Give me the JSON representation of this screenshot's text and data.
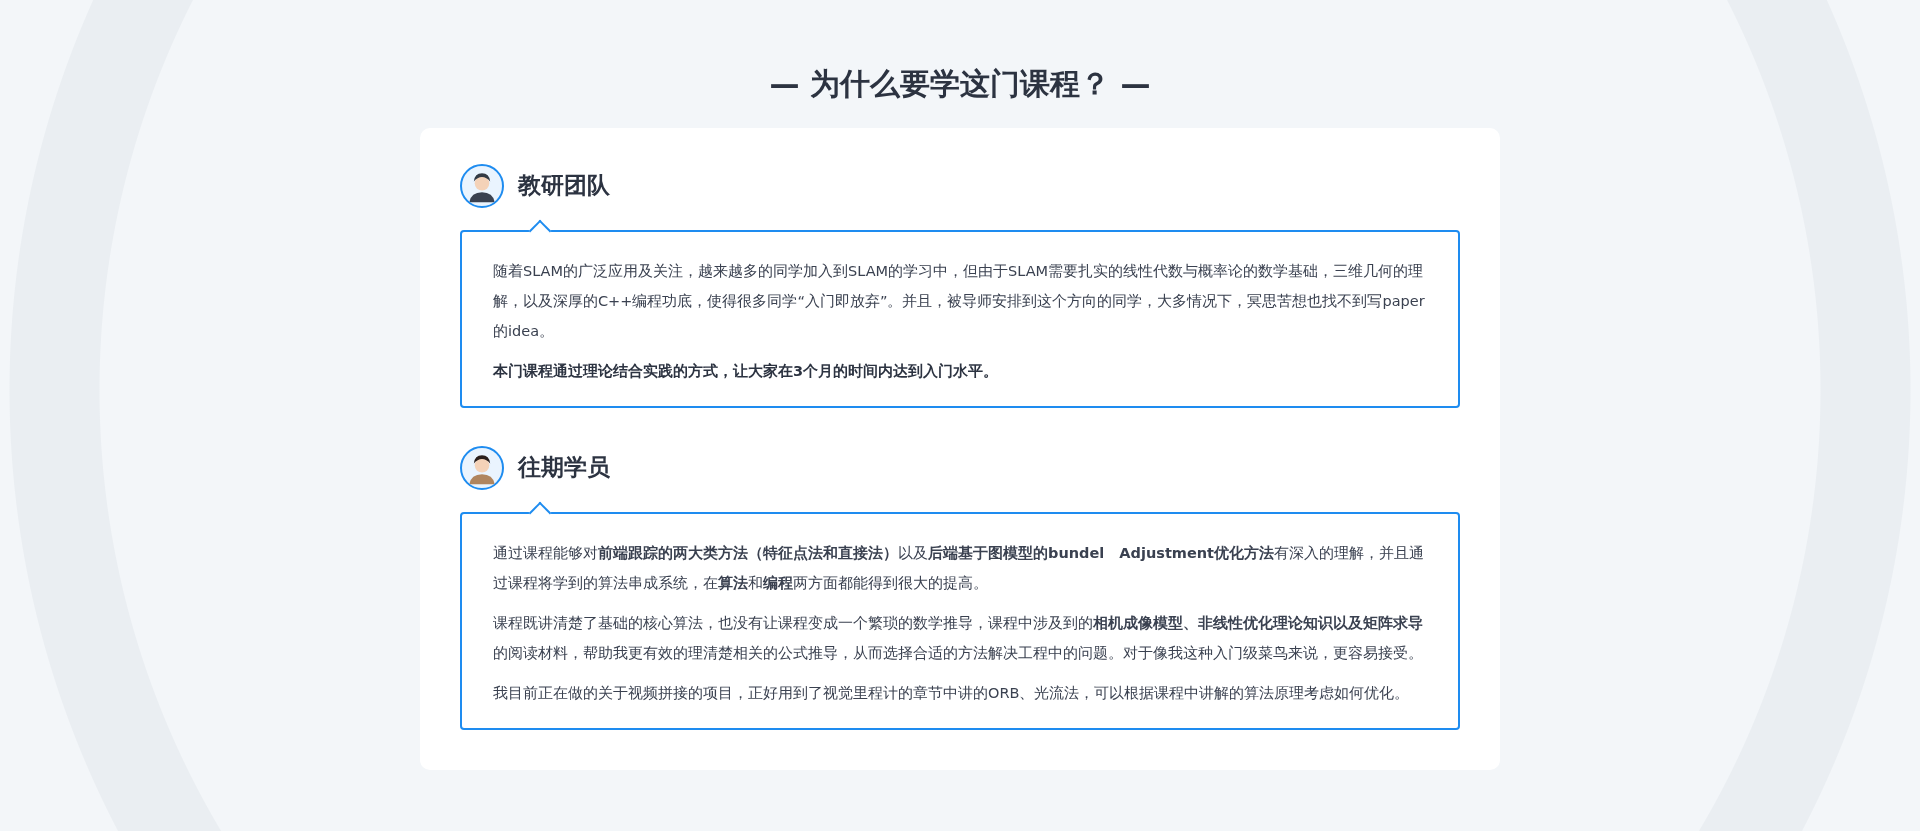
{
  "page_title": "— 为什么要学这门课程？ —",
  "sections": [
    {
      "heading": "教研团队",
      "kind": "teacher",
      "paragraphs": [
        {
          "text": "随着SLAM的广泛应用及关注，越来越多的同学加入到SLAM的学习中，但由于SLAM需要扎实的线性代数与概率论的数学基础，三维几何的理解，以及深厚的C++编程功底，使得很多同学“入门即放弃”。并且，被导师安排到这个方向的同学，大多情况下，冥思苦想也找不到写paper的idea。",
          "bold": false
        },
        {
          "text": "本门课程通过理论结合实践的方式，让大家在3个月的时间内达到入门水平。",
          "bold": true
        }
      ]
    },
    {
      "heading": "往期学员",
      "kind": "student",
      "paragraphs": [
        {
          "text": "通过课程能够对**前端跟踪的两大类方法（特征点法和直接法）**以及**后端基于图模型的bundel   Adjustment优化方法**有深入的理解，并且通过课程将学到的算法串成系统，在**算法**和**编程**两方面都能得到很大的提高。",
          "bold": false
        },
        {
          "text": "课程既讲清楚了基础的核心算法，也没有让课程变成一个繁琐的数学推导，课程中涉及到的**相机成像模型、非线性优化理论知识以及矩阵求导**的阅读材料，帮助我更有效的理清楚相关的公式推导，从而选择合适的方法解决工程中的问题。对于像我这种入门级菜鸟来说，更容易接受。",
          "bold": false
        },
        {
          "text": "我目前正在做的关于视频拼接的项目，正好用到了视觉里程计的章节中讲的ORB、光流法，可以根据课程中讲解的算法原理考虑如何优化。",
          "bold": false
        }
      ]
    }
  ]
}
